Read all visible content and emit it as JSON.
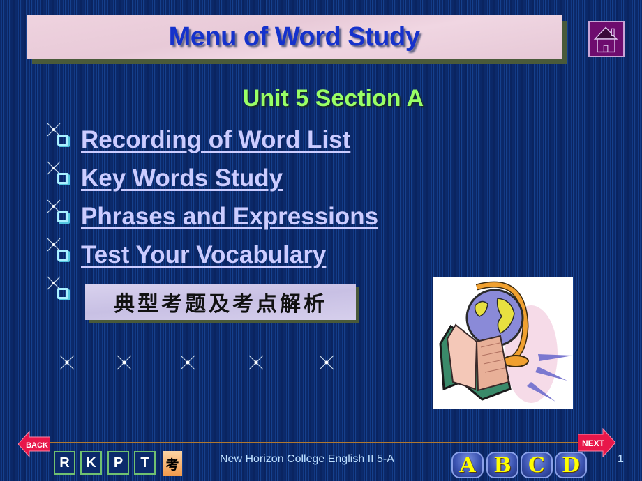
{
  "header": {
    "title": "Menu of Word Study",
    "home_icon": "home-icon"
  },
  "subtitle": "Unit 5 Section A",
  "menu": {
    "items": [
      {
        "label": "Recording of Word List"
      },
      {
        "label": "Key Words Study"
      },
      {
        "label": "Phrases and Expressions"
      },
      {
        "label": "Test Your Vocabulary"
      }
    ],
    "banner_label": "典型考题及考点解析"
  },
  "clipart": "globe-and-book-illustration",
  "footer": {
    "back_label": "BACK",
    "next_label": "NEXT",
    "letter_nav": [
      "R",
      "K",
      "P",
      "T"
    ],
    "kao_label": "考",
    "course_text": "New Horizon College English II 5-A",
    "answer_buttons": [
      "A",
      "B",
      "C",
      "D"
    ],
    "page_number": "1"
  },
  "colors": {
    "background": "#0c2a6b",
    "title_text": "#1532cc",
    "subtitle_text": "#99ff66",
    "link_text": "#ccccff",
    "footer_rule": "#b07830",
    "back_next": "#e8174a"
  }
}
